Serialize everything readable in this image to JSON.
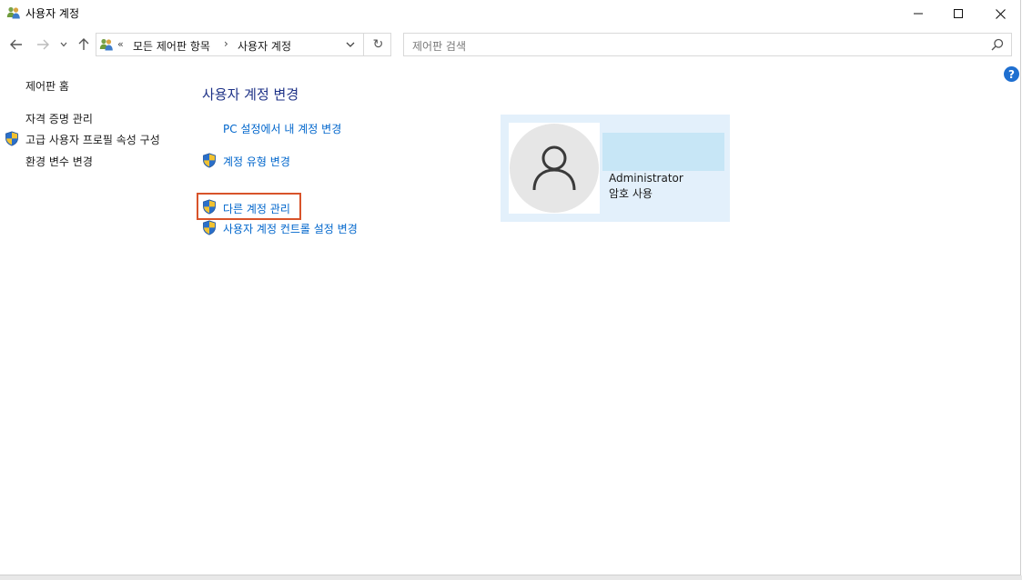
{
  "window": {
    "title": "사용자 계정",
    "icon": "user-accounts-icon"
  },
  "navigation": {
    "back_icon": "back-arrow-icon",
    "forward_icon": "forward-arrow-icon",
    "recent_icon": "chevron-down-icon",
    "up_icon": "up-arrow-icon",
    "address": {
      "chevrons": "«",
      "crumbs": [
        "모든 제어판 항목",
        "사용자 계정"
      ],
      "separator": "›",
      "refresh_glyph": "↻"
    },
    "search": {
      "placeholder": "제어판 검색"
    }
  },
  "help": {
    "glyph": "?"
  },
  "sidebar": {
    "home": "제어판 홈",
    "items": [
      {
        "label": "자격 증명 관리",
        "shield": false
      },
      {
        "label": "고급 사용자 프로필 속성 구성",
        "shield": true
      },
      {
        "label": "환경 변수 변경",
        "shield": false
      }
    ]
  },
  "main": {
    "title": "사용자 계정 변경",
    "tasks": [
      {
        "label": "PC 설정에서 내 계정 변경",
        "shield": false
      },
      {
        "label": "계정 유형 변경",
        "shield": true
      },
      {
        "label": "다른 계정 관리",
        "shield": true,
        "highlighted": true
      },
      {
        "label": "사용자 계정 컨트롤 설정 변경",
        "shield": true
      }
    ]
  },
  "account": {
    "name": "Administrator",
    "status": "암호 사용",
    "avatar_icon": "user-silhouette-icon"
  },
  "colors": {
    "link": "#0066cc",
    "title": "#1e3287",
    "tile_bg": "#e3f0fb",
    "highlight_border": "#d8532a"
  }
}
